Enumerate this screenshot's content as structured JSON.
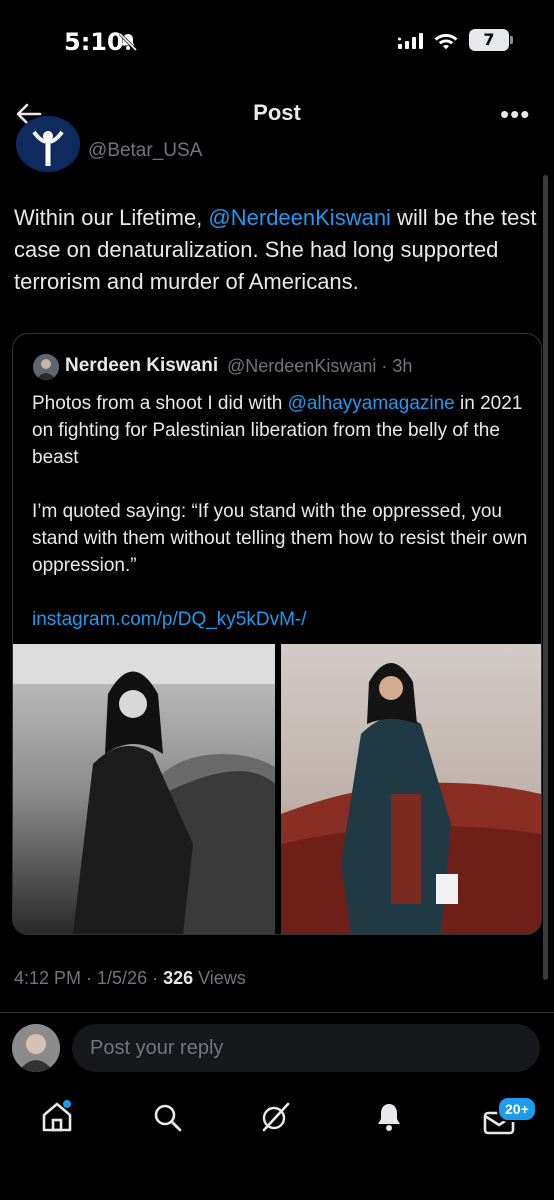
{
  "status_bar": {
    "time": "5:10",
    "battery": "7"
  },
  "header": {
    "title": "Post"
  },
  "tweet": {
    "author_handle": "@Betar_USA",
    "text_before": "Within our Lifetime, ",
    "mention": "@NerdeenKiswani",
    "text_after": " will be the test case on denaturalization. She had long supported terrorism and murder of Americans.",
    "timestamp": "4:12 PM · 1/5/26 · ",
    "views_count": "326",
    "views_label": " Views"
  },
  "quote": {
    "name": "Nerdeen Kiswani",
    "handle_time": "@NerdeenKiswani · 3h",
    "p1_before": "Photos from a shoot I did with ",
    "p1_mention": "@alhayyamagazine",
    "p1_after": " in 2021 on fighting for Palestinian liberation from the belly of the beast",
    "p2": "I’m quoted saying: “If you stand with the oppressed, you stand with them without telling them how to resist their own oppression.”",
    "link": "instagram.com/p/DQ_ky5kDvM-/"
  },
  "reply": {
    "placeholder": "Post your reply"
  },
  "tabbar": {
    "notification_badge": "20+"
  },
  "colors": {
    "accent": "#1d9bf0",
    "background": "#000000",
    "secondary_text": "#71767b",
    "border": "#2f3336"
  }
}
